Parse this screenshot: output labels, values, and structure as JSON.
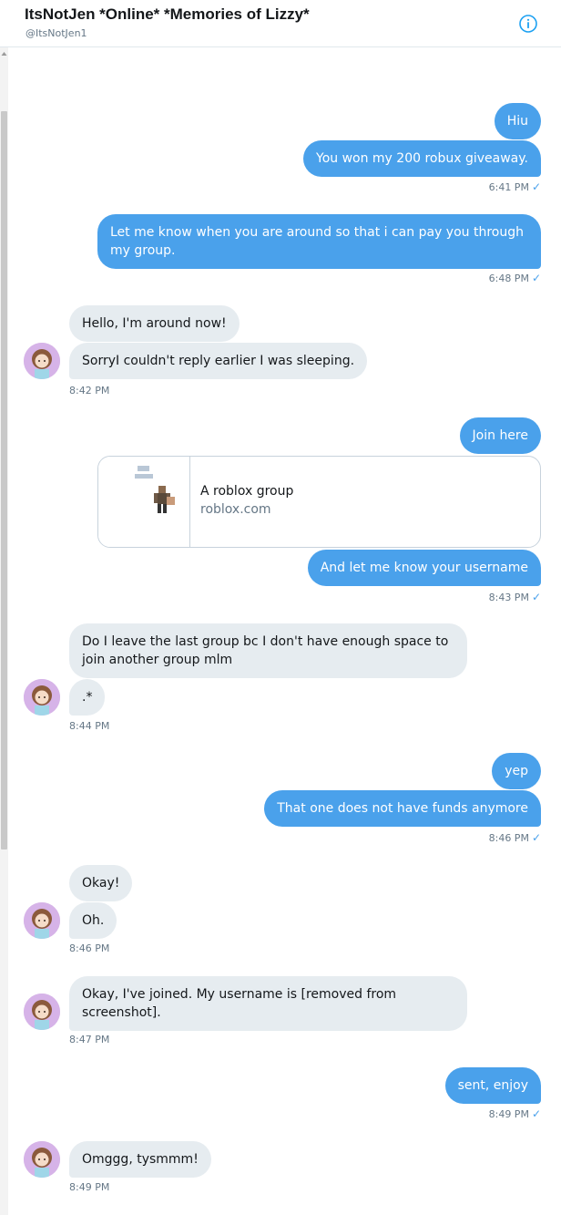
{
  "header": {
    "title": "ItsNotJen *Online* *Memories of Lizzy*",
    "handle": "@ItsNotJen1",
    "info_icon": "info-icon"
  },
  "colors": {
    "outgoing": "#4aa1eb",
    "incoming": "#e6ecf0",
    "meta_text": "#657786"
  },
  "messages": [
    {
      "from": "me",
      "text": "Hiu"
    },
    {
      "from": "me",
      "text": "You won my 200 robux giveaway."
    },
    {
      "from": "me",
      "text": "Let me know when you are around so that i can pay you through my group."
    },
    {
      "from": "them",
      "text": "Hello, I'm around now!"
    },
    {
      "from": "them",
      "text": "SorryI couldn't reply earlier  I was sleeping."
    },
    {
      "from": "me",
      "text": "Join here"
    },
    {
      "from": "me",
      "text": "And let me know your username"
    },
    {
      "from": "them",
      "text": "Do I leave the last group bc I don't have enough space to join another group mlm"
    },
    {
      "from": "them",
      "text": ".*"
    },
    {
      "from": "me",
      "text": "yep"
    },
    {
      "from": "me",
      "text": "That one does not have funds anymore"
    },
    {
      "from": "them",
      "text": "Okay!"
    },
    {
      "from": "them",
      "text": "Oh."
    },
    {
      "from": "them",
      "text": "Okay, I've joined. My username is [removed from screenshot]."
    },
    {
      "from": "me",
      "text": "sent, enjoy"
    },
    {
      "from": "them",
      "text": "Omggg, tysmmm!"
    }
  ],
  "timestamps": [
    "6:41 PM",
    "6:48 PM",
    "8:42 PM",
    "8:43 PM",
    "8:44 PM",
    "8:46 PM",
    "8:46 PM",
    "8:47 PM",
    "8:49 PM",
    "8:49 PM"
  ],
  "read_receipt": "✓",
  "link_card": {
    "title": "A roblox group",
    "domain": "roblox.com"
  }
}
